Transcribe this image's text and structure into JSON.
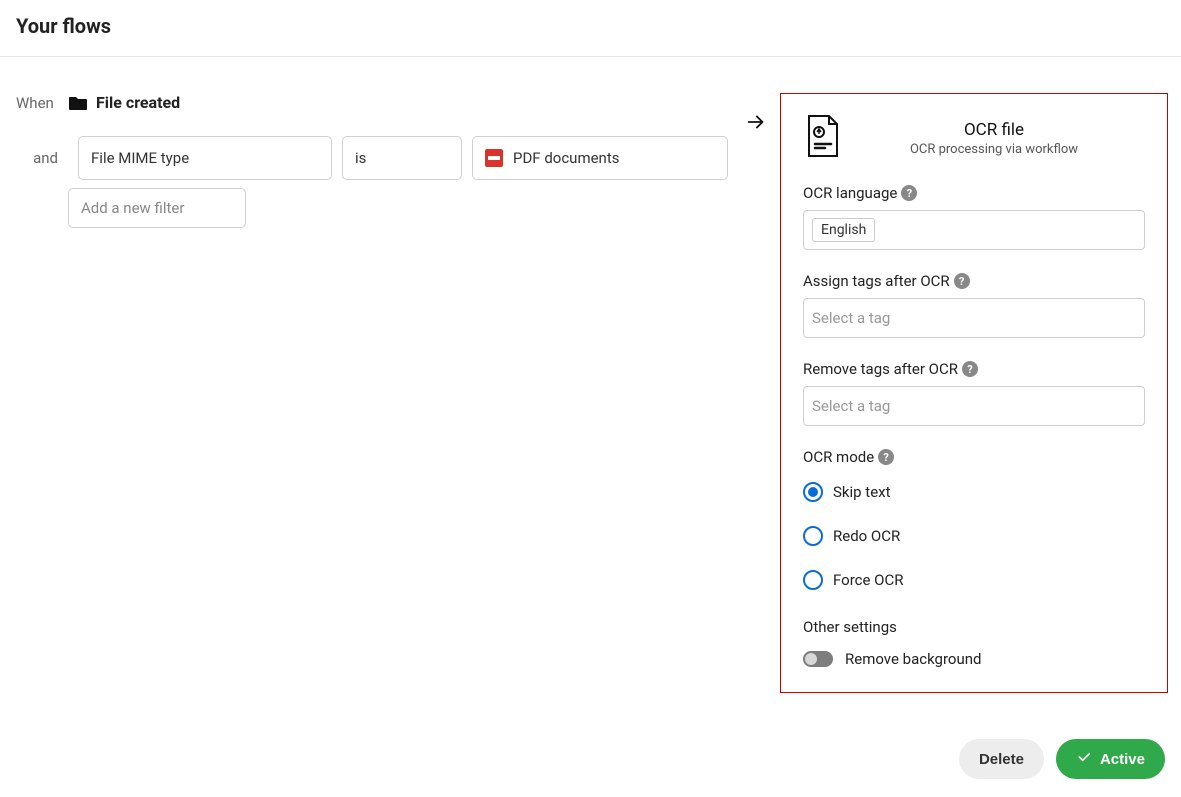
{
  "page": {
    "title": "Your flows"
  },
  "trigger": {
    "when_label": "When",
    "and_label": "and",
    "event": "File created",
    "filter": {
      "field": "File MIME type",
      "op": "is",
      "value": "PDF documents"
    },
    "add_filter_placeholder": "Add a new filter"
  },
  "action": {
    "title": "OCR file",
    "subtitle": "OCR processing via workflow",
    "fields": {
      "language_label": "OCR language",
      "language_value": "English",
      "assign_tags_label": "Assign tags after OCR",
      "assign_tags_placeholder": "Select a tag",
      "remove_tags_label": "Remove tags after OCR",
      "remove_tags_placeholder": "Select a tag",
      "mode_label": "OCR mode",
      "mode_options": {
        "skip": "Skip text",
        "redo": "Redo OCR",
        "force": "Force OCR"
      },
      "mode_selected": "skip",
      "other_label": "Other settings",
      "remove_bg_label": "Remove background"
    }
  },
  "footer": {
    "delete": "Delete",
    "active": "Active"
  }
}
